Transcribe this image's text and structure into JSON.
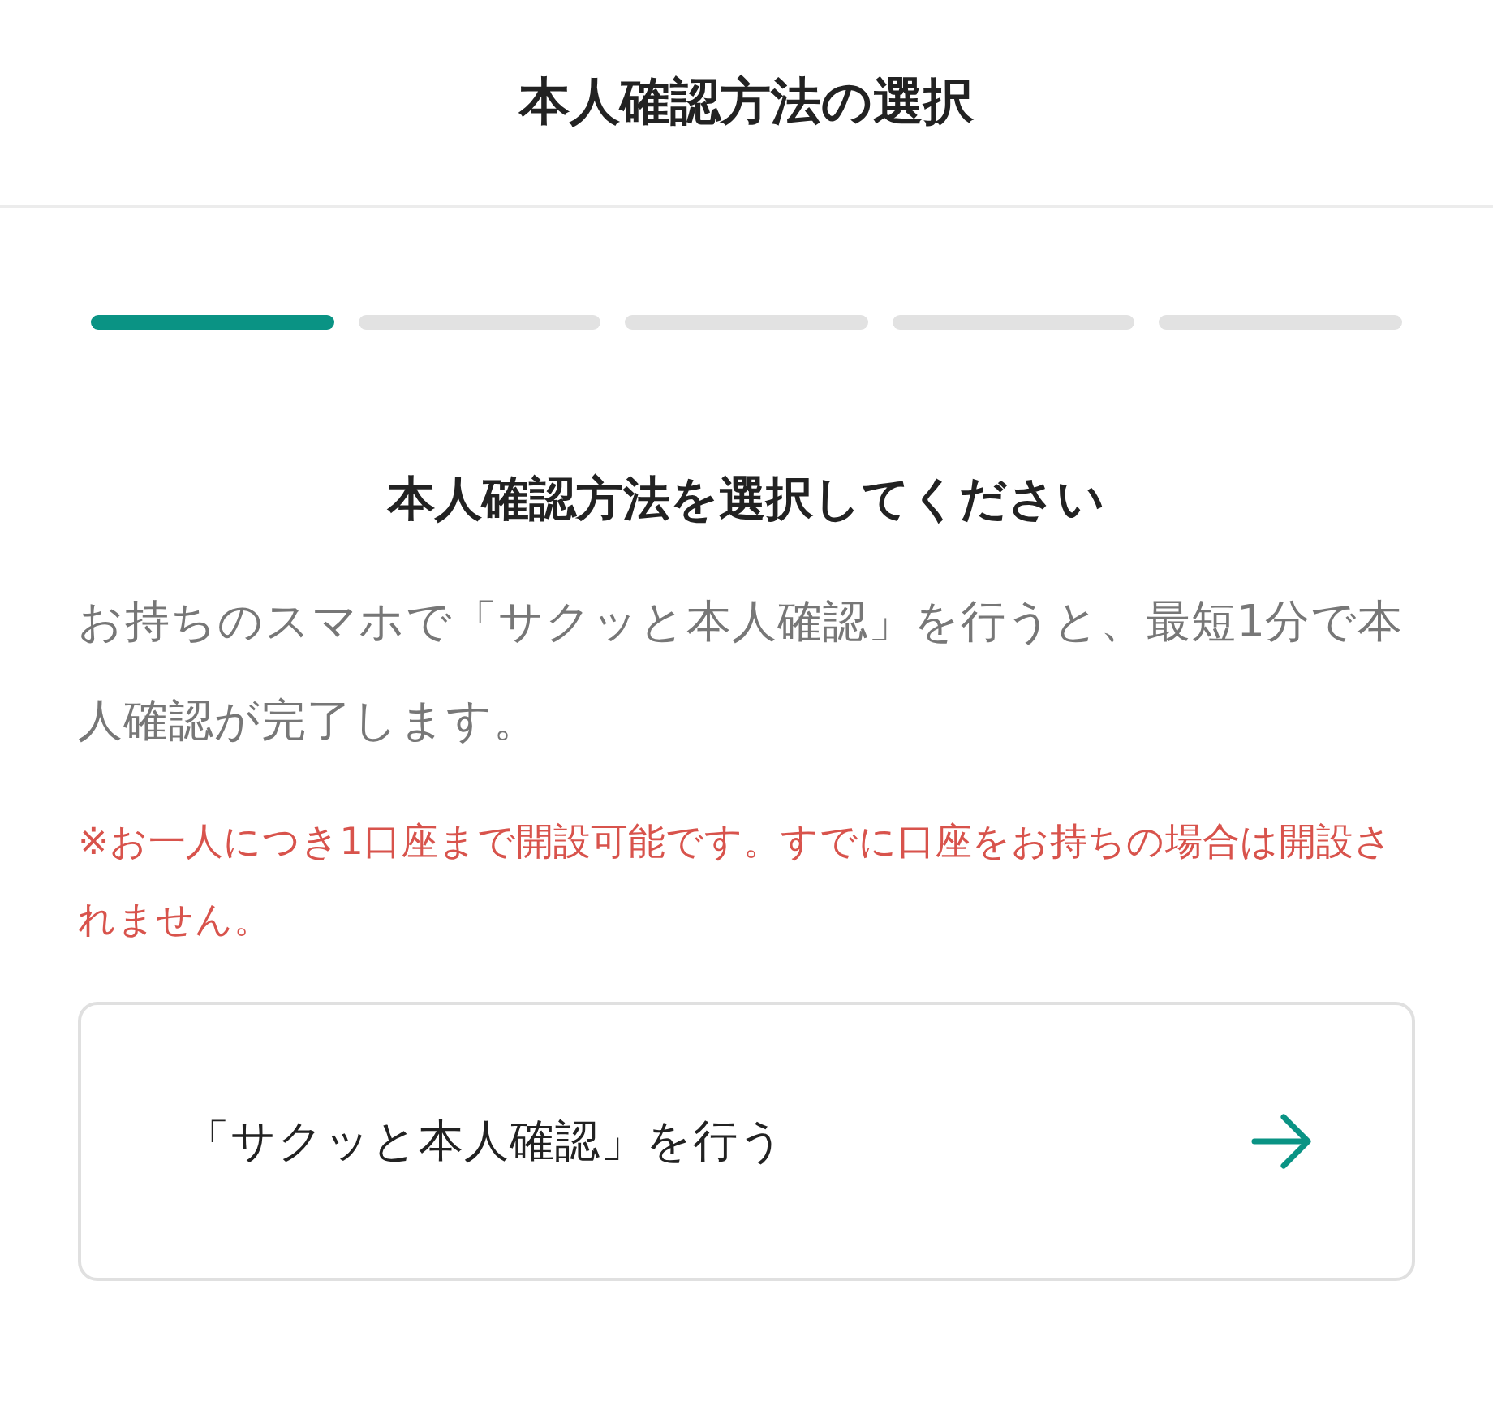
{
  "header": {
    "title": "本人確認方法の選択"
  },
  "progress_steps": [
    {
      "active": true
    },
    {
      "active": false
    },
    {
      "active": false
    },
    {
      "active": false
    },
    {
      "active": false
    }
  ],
  "heading": "本人確認方法を選択してください",
  "description": "お持ちのスマホで「サクッと本人確認」を行うと、最短1分で本人確認が完了します。",
  "notice": "※お一人につき1口座まで開設可能です。すでに口座をお持ちの場合は開設されません。",
  "option_card": {
    "label": "「サクッと本人確認」を行う"
  }
}
